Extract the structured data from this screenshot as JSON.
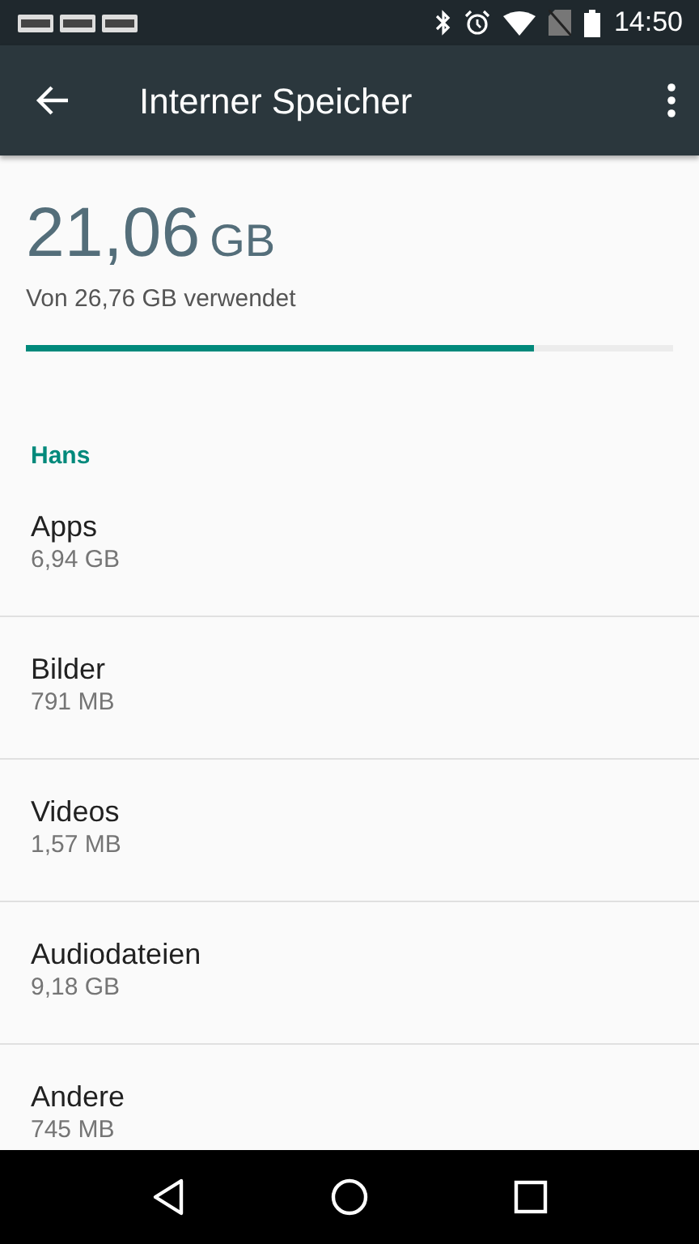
{
  "status_bar": {
    "notifications": [
      {
        "kind": "app"
      },
      {
        "kind": "app"
      },
      {
        "kind": "app"
      }
    ],
    "time": "14:50"
  },
  "toolbar": {
    "title": "Interner Speicher"
  },
  "summary": {
    "used": "21,06",
    "unit": "GB",
    "caption": "Von 26,76 GB verwendet",
    "level": 0.785
  },
  "section": {
    "title": "Hans"
  },
  "items": [
    {
      "title": "Apps",
      "size": "6,94 GB"
    },
    {
      "title": "Bilder",
      "size": "791 MB"
    },
    {
      "title": "Videos",
      "size": "1,57 MB"
    },
    {
      "title": "Audiodateien",
      "size": "9,18 GB"
    },
    {
      "title": "Andere",
      "size": "745 MB"
    }
  ]
}
